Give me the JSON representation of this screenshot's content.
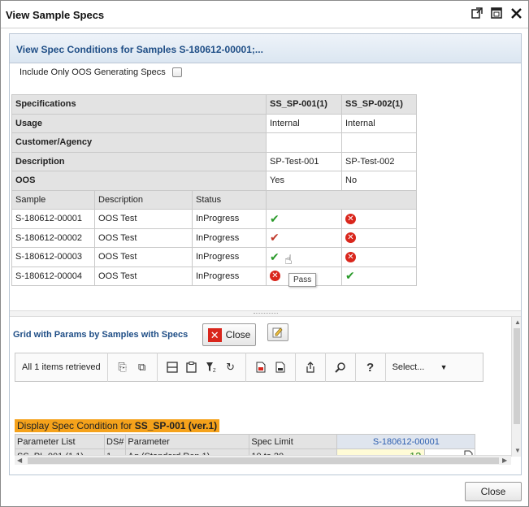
{
  "window": {
    "title": "View Sample Specs"
  },
  "title_icons": [
    "pop-out-icon",
    "maximize-icon",
    "close-icon"
  ],
  "panel": {
    "header": "View Spec Conditions for Samples S-180612-00001;..."
  },
  "oos_filter": {
    "label": "Include Only OOS Generating Specs",
    "checked": false
  },
  "spec_table": {
    "rows": [
      {
        "label": "Specifications",
        "v1": "SS_SP-001(1)",
        "v2": "SS_SP-002(1)"
      },
      {
        "label": "Usage",
        "v1": "Internal",
        "v2": "Internal"
      },
      {
        "label": "Customer/Agency",
        "v1": "",
        "v2": ""
      },
      {
        "label": "Description",
        "v1": "SP-Test-001",
        "v2": "SP-Test-002"
      },
      {
        "label": "OOS",
        "v1": "Yes",
        "v2": "No"
      }
    ],
    "columns": {
      "sample": "Sample",
      "description": "Description",
      "status": "Status"
    },
    "samples": [
      {
        "sample": "S-180612-00001",
        "description": "OOS Test",
        "status": "InProgress",
        "s1": "pass",
        "s2": "fail"
      },
      {
        "sample": "S-180612-00002",
        "description": "OOS Test",
        "status": "InProgress",
        "s1": "pass",
        "s2": "fail"
      },
      {
        "sample": "S-180612-00003",
        "description": "OOS Test",
        "status": "InProgress",
        "s1": "pass",
        "s2": "fail"
      },
      {
        "sample": "S-180612-00004",
        "description": "OOS Test",
        "status": "InProgress",
        "s1": "fail",
        "s2": "pass"
      }
    ]
  },
  "tooltip": "Pass",
  "lower": {
    "title": "Grid with Params by Samples with Specs",
    "close_label": "Close",
    "toolbar": {
      "count_text": "All 1 items retrieved",
      "select_label": "Select..."
    },
    "display_prefix": "Display Spec Condition for ",
    "display_spec": "SS_SP-001 (ver.1)",
    "params": {
      "headers": {
        "parameter_list": "Parameter List",
        "ds": "DS#",
        "parameter": "Parameter",
        "spec_limit": "Spec Limit",
        "sample": "S-180612-00001"
      },
      "row": {
        "parameter_list": "SS_PL-001 (1,1)",
        "ds": "1",
        "parameter": "Ag (Standard Rep 1)",
        "spec_limit": "10 to 20",
        "value": "12"
      }
    }
  },
  "footer": {
    "close_label": "Close"
  }
}
